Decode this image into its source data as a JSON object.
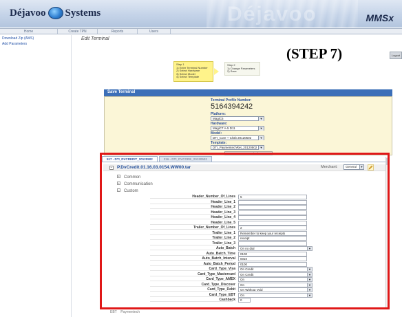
{
  "header": {
    "brand_left": "Déjavoo",
    "brand_right": "Systems",
    "app_name": "MMSx",
    "faded_text": "Déjavoo"
  },
  "nav": {
    "tabs": [
      "Home",
      "Create TPN",
      "Reports",
      "Users"
    ]
  },
  "sidebar": {
    "links": [
      "Download Zip (AMS)",
      "Add Parameters"
    ]
  },
  "page": {
    "title": "Edit Terminal",
    "logout_label": "Logout",
    "annotation": "(STEP 7)"
  },
  "steps": {
    "step1": {
      "title": "Step 1",
      "items": [
        "1) Enter Terminal Number",
        "2) Select Hardware",
        "3) Select Model",
        "4) Select Template"
      ]
    },
    "step2": {
      "title": "Step 2",
      "items": [
        "1) Change Parameters",
        "2) Save"
      ]
    }
  },
  "save_terminal": {
    "header": "Save Terminal",
    "tpn_label": "Terminal Profile Number:",
    "tpn_value": "5164394242",
    "platform_label": "Platform:",
    "platform_value": "MagiC5",
    "hardware_label": "Hardware:",
    "hardware_value": "MagiC7 A-5 D11",
    "model_label": "Model:",
    "model_value": "DTI_Core + C/Db 20120502",
    "template_label": "Template:",
    "template_value": "DTI_PaymentechRet_20120502",
    "save_button": "Save Terminal"
  },
  "params": {
    "tabs": [
      {
        "label": "517 - DTI_DVCREDIT_20120502",
        "active": true
      },
      {
        "label": "316 - DTI_DVCORE_20120502",
        "active": false
      }
    ],
    "file_name": "P.DvCredit.01.16.03.0154.WW00.tar",
    "merchant_label": "Merchant:",
    "merchant_value": "General",
    "sections": [
      "Common",
      "Communication",
      "Custom"
    ],
    "rows": [
      {
        "label": "Header_Number_Of_Lines",
        "value": "5",
        "type": "text"
      },
      {
        "label": "Header_Line_1",
        "value": "",
        "type": "text"
      },
      {
        "label": "Header_Line_2",
        "value": "",
        "type": "text"
      },
      {
        "label": "Header_Line_3",
        "value": "",
        "type": "text"
      },
      {
        "label": "Header_Line_4",
        "value": "",
        "type": "text"
      },
      {
        "label": "Header_Line_5",
        "value": "",
        "type": "text"
      },
      {
        "label": "Trailer_Number_Of_Lines",
        "value": "2",
        "type": "text"
      },
      {
        "label": "Trailer_Line_1",
        "value": "Remember to keep your receipts",
        "type": "text"
      },
      {
        "label": "Trailer_Line_2",
        "value": "receipt",
        "type": "text"
      },
      {
        "label": "Trailer_Line_3",
        "value": "",
        "type": "text"
      },
      {
        "label": "Auto_Batch",
        "value": "On no dial",
        "type": "select"
      },
      {
        "label": "Auto_Batch_Time",
        "value": "0100",
        "type": "text"
      },
      {
        "label": "Auto_Batch_Interval",
        "value": "0010",
        "type": "text"
      },
      {
        "label": "Auto_Batch_Period",
        "value": "0100",
        "type": "text"
      },
      {
        "label": "Card_Type_Visa",
        "value": "On Credit",
        "type": "select"
      },
      {
        "label": "Card_Type_Mastercard",
        "value": "On Credit",
        "type": "select"
      },
      {
        "label": "Card_Type_AMEX",
        "value": "On",
        "type": "select"
      },
      {
        "label": "Card_Type_Discover",
        "value": "On",
        "type": "select"
      },
      {
        "label": "Card_Type_Debit",
        "value": "On Without Void",
        "type": "select"
      },
      {
        "label": "Card_Type_EBT",
        "value": "On",
        "type": "select"
      },
      {
        "label": "Cashback",
        "value": "0",
        "type": "short"
      }
    ],
    "bottom_sections": [
      "EBT",
      "Paymentech"
    ]
  },
  "colors": {
    "panel_header": "#3c6fb8",
    "highlight_frame": "#e01818",
    "step_active": "#fff38a"
  }
}
